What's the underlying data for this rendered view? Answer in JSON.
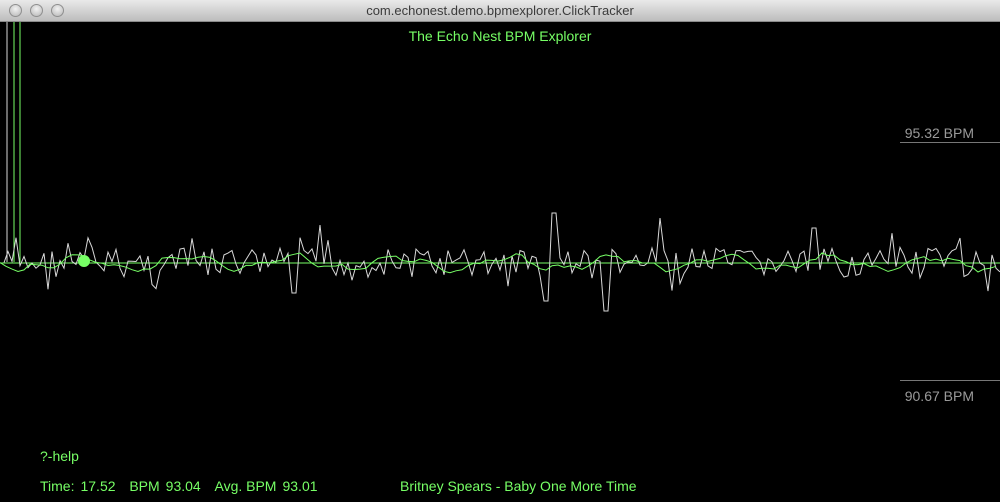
{
  "window": {
    "title": "com.echonest.demo.bpmexplorer.ClickTracker"
  },
  "app": {
    "title": "The Echo Nest BPM Explorer"
  },
  "scale": {
    "upper_label": "95.32 BPM",
    "lower_label": "90.67 BPM"
  },
  "help": {
    "text": "?-help"
  },
  "status": {
    "time_label": "Time:",
    "time_value": "17.52",
    "bpm_label": "BPM",
    "bpm_value": "93.04",
    "avg_label": "Avg. BPM",
    "avg_value": "93.01"
  },
  "track": {
    "title": "Britney Spears - Baby One More Time"
  },
  "colors": {
    "accent": "#77ff66",
    "trace": "#d9d9d9",
    "scale": "#777777"
  }
}
